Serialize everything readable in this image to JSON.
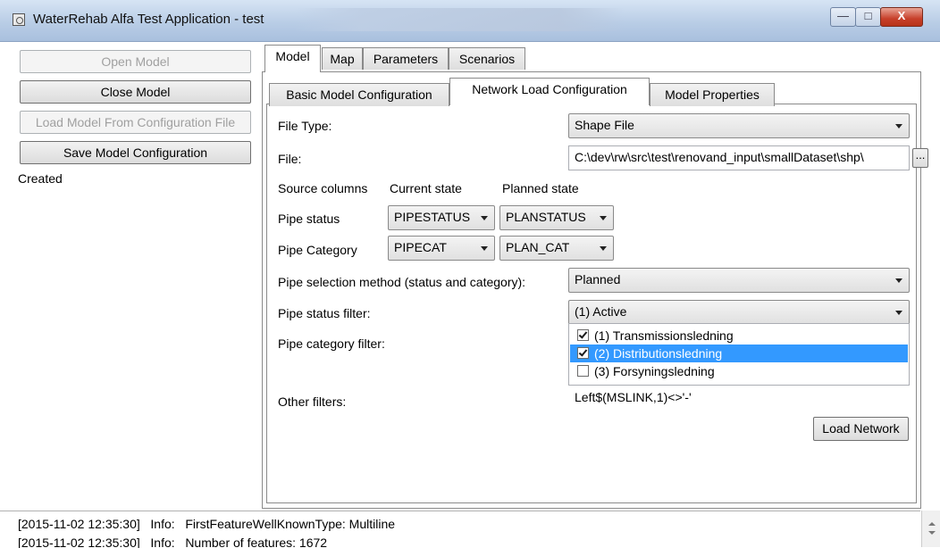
{
  "window": {
    "title": "WaterRehab Alfa Test Application - test",
    "minimize_glyph": "—",
    "maximize_glyph": "□",
    "close_glyph": "X"
  },
  "sidebar": {
    "open_model": "Open Model",
    "close_model": "Close Model",
    "load_from_config": "Load Model From Configuration File",
    "save_config": "Save Model Configuration",
    "status": "Created"
  },
  "tabs": {
    "outer": [
      "Model",
      "Map",
      "Parameters",
      "Scenarios"
    ],
    "inner": [
      "Basic Model Configuration",
      "Network Load Configuration",
      "Model Properties"
    ]
  },
  "form": {
    "file_type_label": "File Type:",
    "file_type_value": "Shape File",
    "file_label": "File:",
    "file_value": "C:\\dev\\rw\\src\\test\\renovand_input\\smallDataset\\shp\\",
    "browse_label": "...",
    "source_columns_label": "Source columns",
    "current_state_label": "Current state",
    "planned_state_label": "Planned state",
    "pipe_status_label": "Pipe status",
    "pipe_status_current": "PIPESTATUS",
    "pipe_status_planned": "PLANSTATUS",
    "pipe_category_label": "Pipe Category",
    "pipe_category_current": "PIPECAT",
    "pipe_category_planned": "PLAN_CAT",
    "selection_method_label": "Pipe selection method (status and category):",
    "selection_method_value": "Planned",
    "status_filter_label": "Pipe status filter:",
    "status_filter_value": "(1) Active",
    "category_filter_label": "Pipe category filter:",
    "category_filter_items": [
      {
        "label": "(1) Transmissionsledning",
        "checked": true,
        "selected": false
      },
      {
        "label": "(2) Distributionsledning",
        "checked": true,
        "selected": true
      },
      {
        "label": "(3) Forsyningsledning",
        "checked": false,
        "selected": false
      }
    ],
    "other_filters_label": "Other filters:",
    "other_filters_value": "Left$(MSLINK,1)<>'-'",
    "load_network": "Load Network"
  },
  "log": {
    "lines": [
      "[2015-11-02 12:35:30]   Info:   FirstFeatureWellKnownType: Multiline",
      "[2015-11-02 12:35:30]   Info:   Number of features: 1672"
    ]
  }
}
